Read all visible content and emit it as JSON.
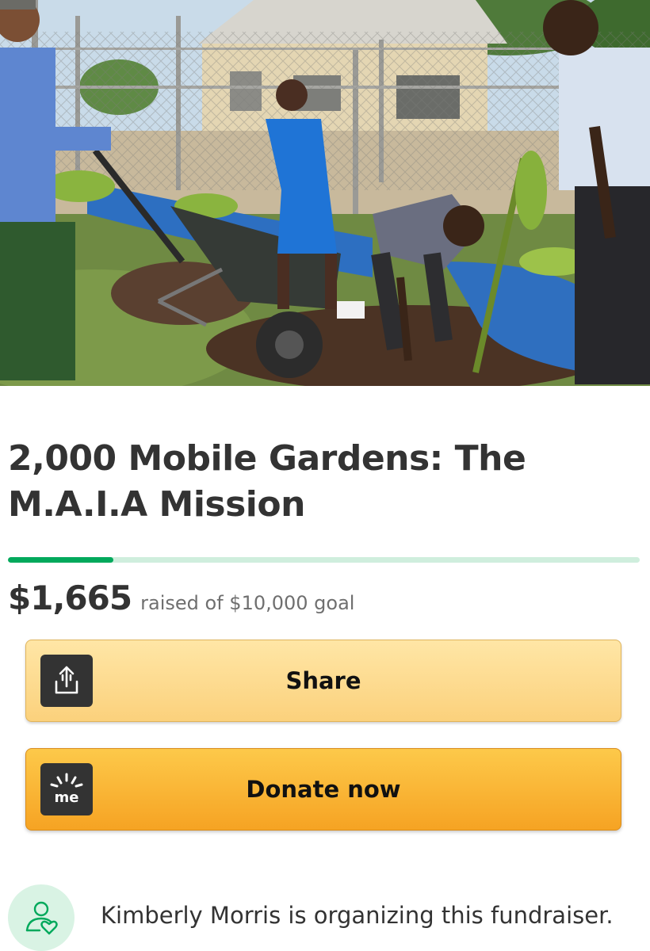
{
  "hero": {
    "image_description_icon": "campaign-photo"
  },
  "campaign": {
    "title": "2,000 Mobile Gardens: The M.A.I.A Mission",
    "raised": "$1,665",
    "goal_text": "raised of $10,000 goal",
    "progress_fraction": 0.1665
  },
  "buttons": {
    "share_label": "Share",
    "share_icon": "share-upload-icon",
    "donate_label": "Donate now",
    "donate_icon": "gofundme-logo-icon",
    "donate_logo_text": "me"
  },
  "organizer": {
    "text": "Kimberly Morris is organizing this fundraiser.",
    "icon": "person-heart-icon"
  },
  "colors": {
    "progress_fill": "#02a95c",
    "progress_track": "#cfeedd",
    "share_button": "#fbd17c",
    "donate_button": "#f6a323",
    "text_dark": "#333333"
  }
}
